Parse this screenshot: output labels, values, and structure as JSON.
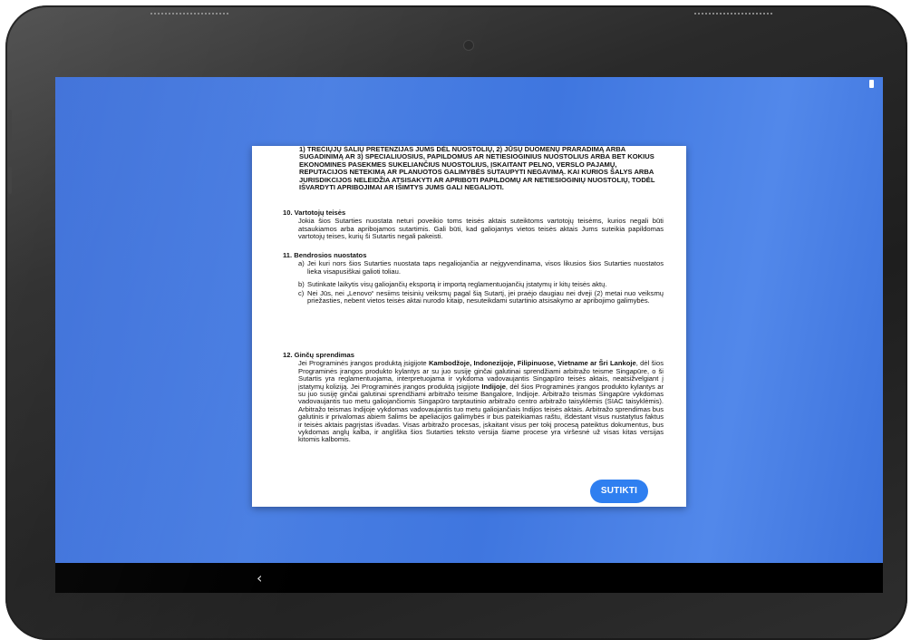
{
  "dialog": {
    "caps_paragraph": "1) TREČIŲJŲ ŠALIŲ PRETENZIJAS JUMS DĖL NUOSTOLIŲ, 2) JŪSŲ DUOMENŲ PRARADIMĄ ARBA SUGADINIMĄ AR 3) SPECIALIUOSIUS, PAPILDOMUS AR NETIESIOGINIUS NUOSTOLIUS ARBA BET KOKIUS EKONOMINES PASEKMES SUKELIANČIUS NUOSTOLIUS, ĮSKAITANT PELNO, VERSLO PAJAMŲ, REPUTACIJOS NETEKIMĄ AR PLANUOTOS GALIMYBĖS SUTAUPYTI NEGAVIMĄ. KAI KURIOS ŠALYS ARBA JURISDIKCIJOS NELEIDŽIA ATSISAKYTI AR APRIBOTI PAPILDOMŲ AR NETIESIOGINIŲ NUOSTOLIŲ, TODĖL IŠVARDYTI APRIBOJIMAI AR IŠIMTYS JUMS GALI NEGALIOTI.",
    "section10": {
      "title": "10.  Vartotojų teisės",
      "body": "Jokia šios Sutarties nuostata neturi poveikio toms teisės aktais suteiktoms vartotojų teisėms, kurios negali būti atsaukiamos arba apribojamos sutartimis. Gali būti, kad galiojantys vietos teisės aktais Jums suteikia papildomas vartotojų teises, kurių ši Sutartis negali pakeisti."
    },
    "section11": {
      "title": "11.  Bendrosios nuostatos",
      "items": [
        {
          "label": "a)",
          "text": "Jei kuri nors šios Sutarties nuostata taps negaliojančia ar neįgyvendinama, visos likusios šios Sutarties nuostatos lieka visapusiškai galioti toliau."
        },
        {
          "label": "b)",
          "text": "Sutinkate laikytis visų galiojančių eksportą ir importą reglamentuojančių įstatymų ir kitų teisės aktų."
        },
        {
          "label": "c)",
          "text": "Nei Jūs, nei „Lenovo“ nesiims teisinių veiksmų pagal šią Sutartį, jei praėjo daugiau nei dveji (2) metai nuo veiksmų priežasties, nebent vietos teisės aktai nurodo kitaip, nesuteikdami sutartinio atsisakymo ar apribojimo galimybės."
        }
      ]
    },
    "section12": {
      "title": "12.  Ginčų sprendimas",
      "body_a": "Jei Programinės įrangos produktą įsigijote ",
      "bold_a": "Kambodžoje, Indonezijoje, Filipinuose, Vietname ar Šri Lankoje",
      "body_b": ", dėl šios Programinės įrangos produkto kylantys ar su juo susiję ginčai galutinai sprendžiami arbitražo teisme Singapūre, o ši Sutartis yra reglamentuojama, interpretuojama ir vykdoma vadovaujantis Singapūro teisės aktais, neatsižvelgiant į įstatymų koliziją. Jei Programinės įrangos produktą įsigijote ",
      "bold_b": "Indijoje",
      "body_c": ", dėl šios Programinės įrangos produkto kylantys ar su juo susiję ginčai galutinai sprendžiami arbitražo teisme Bangalore, Indijoje. Arbitražo teismas Singapūre vykdomas vadovaujantis tuo metu galiojančiomis Singapūro tarptautinio arbitražo centro arbitražo taisyklėmis (SIAC taisyklėmis). Arbitražo teismas Indijoje vykdomas vadovaujantis tuo metu galiojančiais Indijos teisės aktais. Arbitražo sprendimas bus galutinis ir privalomas abiem šalims be apeliacijos galimybės ir bus pateikiamas raštu, išdėstant visus nustatytus faktus ir teisės aktais pagrįstas išvadas. Visas arbitražo procesas, įskaitant visus per tokį procesą pateiktus dokumentus, bus vykdomas anglų kalba, ir angliška šios Sutarties teksto versija šiame procese yra viršesnė už visas kitas versijas kitomis kalbomis."
    },
    "agree_button": "SUTIKTI"
  },
  "navbar": {
    "back_glyph": "‹"
  },
  "colors": {
    "accent": "#2f7ff0",
    "wallpaper": "#4a7fe3",
    "navbar": "#000000"
  },
  "icons": [
    "battery-icon",
    "camera-icon",
    "back-icon"
  ]
}
